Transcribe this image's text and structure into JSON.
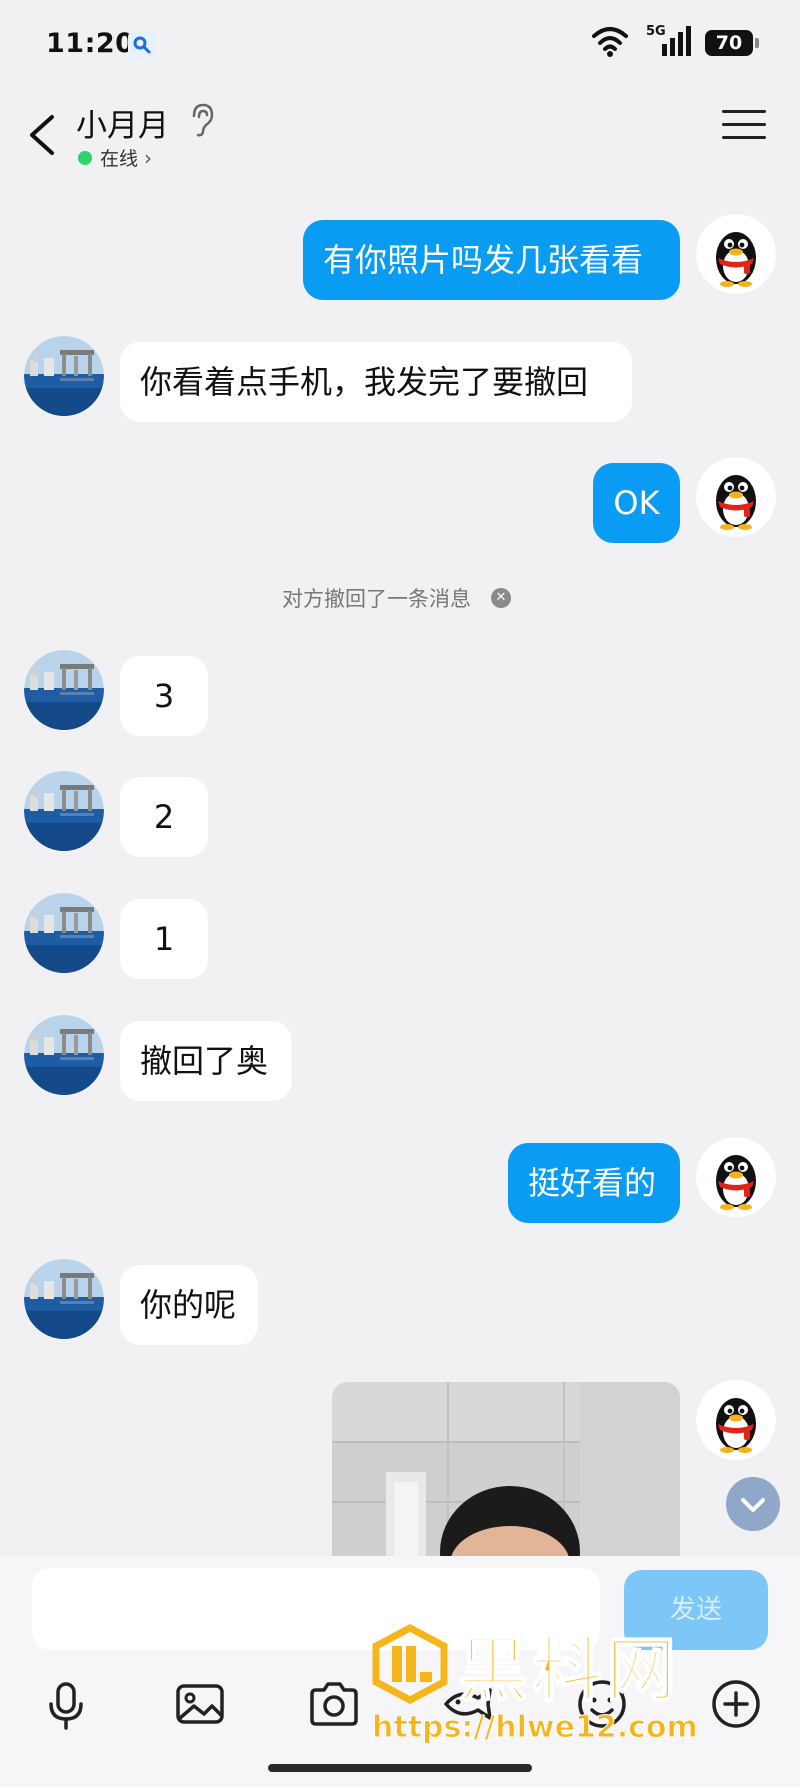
{
  "status_bar": {
    "time": "11:20",
    "network": "5G",
    "battery": "70"
  },
  "header": {
    "contact_name": "小月月",
    "online_status": "在线"
  },
  "colors": {
    "outgoing_bubble": "#0a9bf2",
    "background": "#f1f1f3",
    "online_dot": "#2fd36b",
    "watermark": "#f7b51c"
  },
  "messages": [
    {
      "side": "out",
      "text": "有你照片吗发几张看看"
    },
    {
      "side": "in",
      "text": "你看着点手机，我发完了要撤回"
    },
    {
      "side": "out",
      "text": "OK"
    },
    {
      "side": "system",
      "text": "对方撤回了一条消息"
    },
    {
      "side": "in",
      "text": "3"
    },
    {
      "side": "in",
      "text": "2"
    },
    {
      "side": "in",
      "text": "1"
    },
    {
      "side": "in",
      "text": "撤回了奥"
    },
    {
      "side": "out",
      "text": "挺好看的"
    },
    {
      "side": "in",
      "text": "你的呢"
    },
    {
      "side": "out",
      "type": "image"
    }
  ],
  "composer": {
    "input_value": "",
    "send_label": "发送",
    "tools": [
      "microphone-icon",
      "image-icon",
      "camera-icon",
      "fish-icon",
      "emoji-icon",
      "plus-icon"
    ]
  },
  "watermark": {
    "brand": "黑料网",
    "url": "https://hlwe12.com"
  }
}
